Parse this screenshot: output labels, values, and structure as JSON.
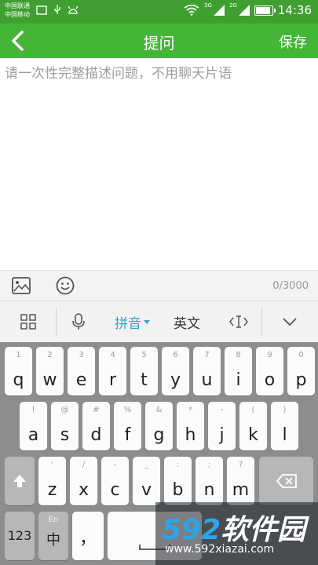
{
  "status_bar": {
    "carrier_1": "中国联通",
    "carrier_2": "中国移动",
    "net_1": "3G",
    "net_2": "2G",
    "time": "14:36"
  },
  "header": {
    "title": "提问",
    "save_label": "保存"
  },
  "editor": {
    "placeholder": "请一次性完整描述问题，不用聊天片语",
    "value": "",
    "counter": "0/3000"
  },
  "ime_bar": {
    "pinyin": "拼音",
    "english": "英文"
  },
  "keyboard": {
    "row1": [
      {
        "hint": "1",
        "key": "q"
      },
      {
        "hint": "2",
        "key": "w"
      },
      {
        "hint": "3",
        "key": "e"
      },
      {
        "hint": "4",
        "key": "r"
      },
      {
        "hint": "5",
        "key": "t"
      },
      {
        "hint": "6",
        "key": "y"
      },
      {
        "hint": "7",
        "key": "u"
      },
      {
        "hint": "8",
        "key": "i"
      },
      {
        "hint": "9",
        "key": "o"
      },
      {
        "hint": "0",
        "key": "p"
      }
    ],
    "row2": [
      {
        "hint": "!",
        "key": "a"
      },
      {
        "hint": "@",
        "key": "s"
      },
      {
        "hint": "#",
        "key": "d"
      },
      {
        "hint": "%",
        "key": "f"
      },
      {
        "hint": "&",
        "key": "g"
      },
      {
        "hint": "*",
        "key": "h"
      },
      {
        "hint": "-",
        "key": "j"
      },
      {
        "hint": "(",
        "key": "k"
      },
      {
        "hint": ")",
        "key": "l"
      }
    ],
    "row3": [
      {
        "hint": "‘",
        "key": "z"
      },
      {
        "hint": "/",
        "key": "x"
      },
      {
        "hint": "–",
        "key": "c"
      },
      {
        "hint": "_",
        "key": "v"
      },
      {
        "hint": ":",
        "key": "b"
      },
      {
        "hint": ";",
        "key": "n"
      },
      {
        "hint": "?",
        "key": "m"
      }
    ],
    "num_key": "123",
    "lang_hint": "En",
    "lang_key": "中",
    "comma_key": "，"
  },
  "watermark": {
    "logo_num": "592",
    "logo_text": "软件园",
    "url": "www.592xiazai.com"
  },
  "colors": {
    "accent": "#45b537",
    "statusbar": "#3f9f30",
    "ime_active": "#2aa9c2"
  }
}
